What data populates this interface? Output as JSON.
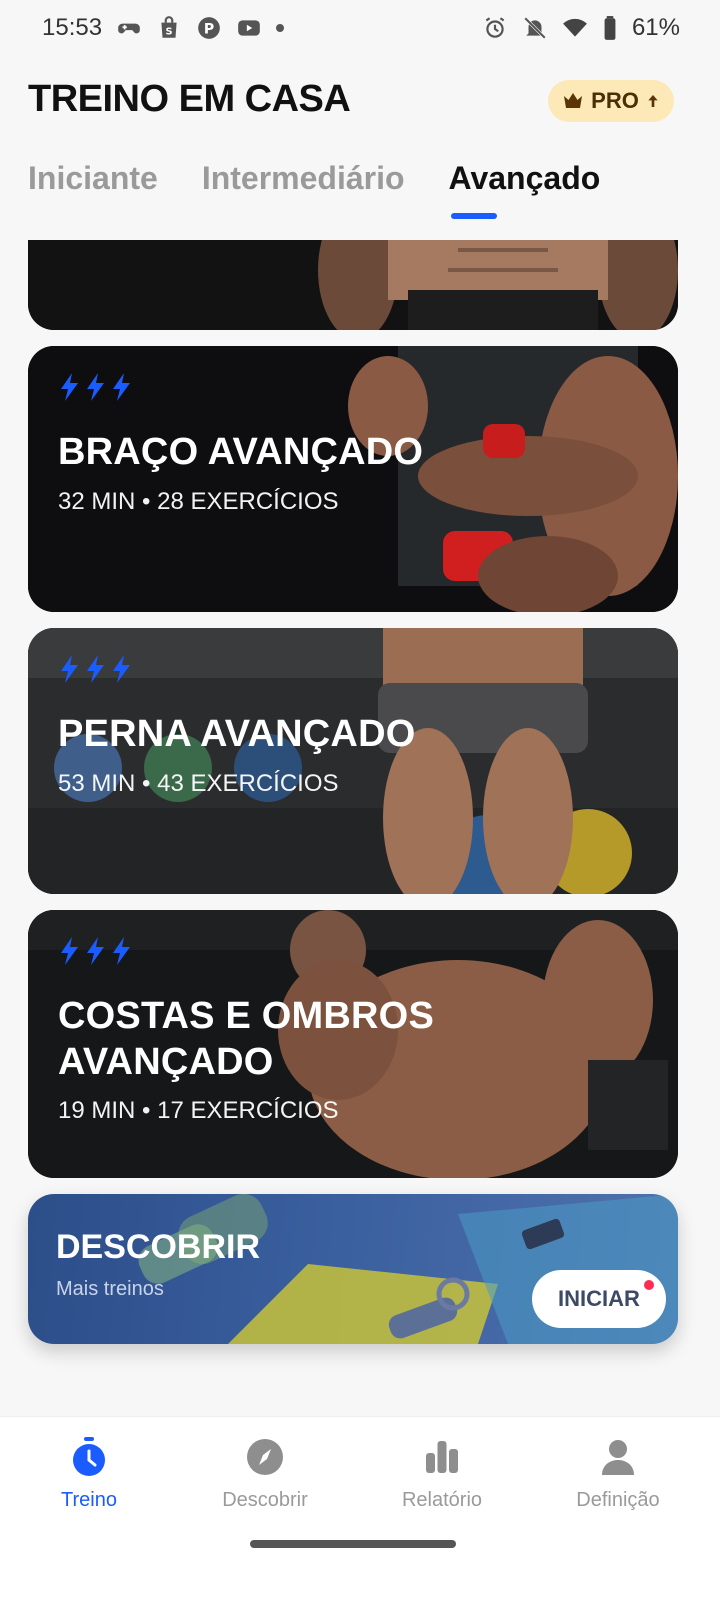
{
  "status_bar": {
    "time": "15:53",
    "battery": "61%",
    "left_icons": [
      "game-controller-icon",
      "shopping-bag-icon",
      "pinterest-icon",
      "youtube-icon"
    ],
    "right_icons": [
      "alarm-icon",
      "bell-off-icon",
      "wifi-icon",
      "battery-icon"
    ]
  },
  "header": {
    "title": "TREINO EM CASA",
    "pro_label": "PRO"
  },
  "tabs": [
    {
      "label": "Iniciante",
      "active": false
    },
    {
      "label": "Intermediário",
      "active": false
    },
    {
      "label": "Avançado",
      "active": true
    }
  ],
  "cards": [
    {
      "title": "BRAÇO AVANÇADO",
      "meta": "32 MIN • 28 EXERCÍCIOS"
    },
    {
      "title": "PERNA AVANÇADO",
      "meta": "53 MIN • 43 EXERCÍCIOS"
    },
    {
      "title": "COSTAS E OMBROS AVANÇADO",
      "meta": "19 MIN • 17 EXERCÍCIOS"
    }
  ],
  "discover": {
    "title": "DESCOBRIR",
    "subtitle": "Mais treinos",
    "button": "INICIAR"
  },
  "bottom_nav": [
    {
      "label": "Treino",
      "icon": "stopwatch-icon",
      "active": true
    },
    {
      "label": "Descobrir",
      "icon": "compass-icon",
      "active": false
    },
    {
      "label": "Relatório",
      "icon": "bar-chart-icon",
      "active": false
    },
    {
      "label": "Definição",
      "icon": "person-icon",
      "active": false
    }
  ],
  "colors": {
    "accent": "#1b5cff",
    "pro_badge_bg": "#fde9b8",
    "notification_dot": "#ff2b55"
  }
}
